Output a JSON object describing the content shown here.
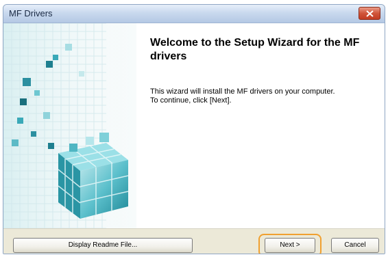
{
  "window": {
    "title": "MF Drivers",
    "close_icon": "close-icon"
  },
  "wizard": {
    "heading": "Welcome to the Setup Wizard for the MF drivers",
    "description_line1": "This wizard will install the MF drivers on your computer.",
    "description_line2": "To continue, click [Next]."
  },
  "buttons": {
    "readme_label": "Display Readme File...",
    "next_label": "Next >",
    "cancel_label": "Cancel"
  },
  "colors": {
    "highlight": "#f0a030",
    "cube_teal": "#2fa3b3"
  }
}
